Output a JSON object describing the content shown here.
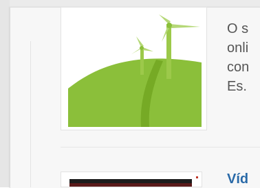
{
  "article": {
    "image": "wind-turbines-on-green-hill",
    "excerpt_lines": [
      "O s",
      "onli",
      "con",
      "Es."
    ]
  },
  "next_article": {
    "title": "Víd"
  },
  "colors": {
    "hill": "#8bbf3a",
    "hill_dark": "#6fa31f",
    "turbine": "#9cc94a",
    "link": "#2a6aa8",
    "text": "#555555"
  }
}
